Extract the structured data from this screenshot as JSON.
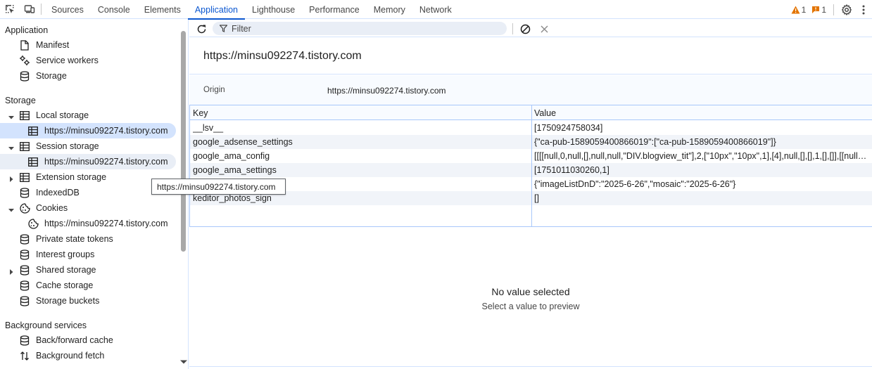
{
  "topbar": {
    "tabs": [
      "Sources",
      "Console",
      "Elements",
      "Application",
      "Lighthouse",
      "Performance",
      "Memory",
      "Network"
    ],
    "active_tab": "Application",
    "warnings_count": "1",
    "issues_count": "1"
  },
  "sidebar": {
    "application_title": "Application",
    "application_items": [
      "Manifest",
      "Service workers",
      "Storage"
    ],
    "storage_title": "Storage",
    "local_storage": "Local storage",
    "local_storage_child": "https://minsu092274.tistory.com",
    "session_storage": "Session storage",
    "session_storage_child": "https://minsu092274.tistory.com",
    "extension_storage": "Extension storage",
    "indexeddb": "IndexedDB",
    "cookies": "Cookies",
    "cookies_child": "https://minsu092274.tistory.com",
    "more_storage": [
      "Private state tokens",
      "Interest groups",
      "Shared storage",
      "Cache storage",
      "Storage buckets"
    ],
    "background_title": "Background services",
    "background_items": [
      "Back/forward cache",
      "Background fetch"
    ]
  },
  "toolbar": {
    "filter_placeholder": "Filter"
  },
  "origin": {
    "header": "https://minsu092274.tistory.com",
    "label": "Origin",
    "value": "https://minsu092274.tistory.com"
  },
  "table": {
    "headers": [
      "Key",
      "Value"
    ],
    "rows": [
      {
        "key": "__lsv__",
        "value": "[1750924758034]"
      },
      {
        "key": "google_adsense_settings",
        "value": "{\"ca-pub-1589059400866019\":[\"ca-pub-1589059400866019\"]}"
      },
      {
        "key": "google_ama_config",
        "value": "[[[[null,0,null,[],null,null,\"DIV.blogview_tit\"],2,[\"10px\",\"10px\",1],[4],null,[],[],1,[],[]],[[null,8,n..."
      },
      {
        "key": "google_ama_settings",
        "value": "[1751011030260,1]"
      },
      {
        "key": "",
        "value": "{\"imageListDnD\":\"2025-6-26\",\"mosaic\":\"2025-6-26\"}"
      },
      {
        "key": "keditor_photos_sign",
        "value": "[]"
      }
    ]
  },
  "preview": {
    "title": "No value selected",
    "subtitle": "Select a value to preview"
  },
  "tooltip": "https://minsu092274.tistory.com",
  "colors": {
    "accent": "#0b57d0",
    "selected_bg": "#d3e3fd",
    "warning": "#e37400"
  }
}
